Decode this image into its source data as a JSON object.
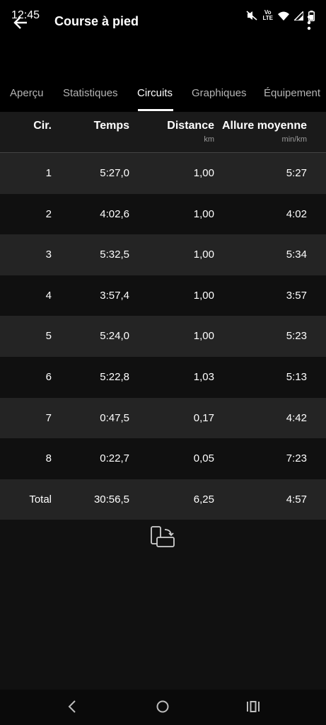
{
  "status": {
    "time": "12:45",
    "volte": "Vo\nLTE"
  },
  "appbar": {
    "title": "Course à pied"
  },
  "tabs": [
    "Aperçu",
    "Statistiques",
    "Circuits",
    "Graphiques",
    "Équipement"
  ],
  "table": {
    "headers": {
      "lap": "Cir.",
      "time": "Temps",
      "distance": "Distance",
      "distance_unit": "km",
      "pace": "Allure moyenne",
      "pace_unit": "min/km"
    },
    "rows": [
      {
        "lap": "1",
        "time": "5:27,0",
        "distance": "1,00",
        "pace": "5:27"
      },
      {
        "lap": "2",
        "time": "4:02,6",
        "distance": "1,00",
        "pace": "4:02"
      },
      {
        "lap": "3",
        "time": "5:32,5",
        "distance": "1,00",
        "pace": "5:34"
      },
      {
        "lap": "4",
        "time": "3:57,4",
        "distance": "1,00",
        "pace": "3:57"
      },
      {
        "lap": "5",
        "time": "5:24,0",
        "distance": "1,00",
        "pace": "5:23"
      },
      {
        "lap": "6",
        "time": "5:22,8",
        "distance": "1,03",
        "pace": "5:13"
      },
      {
        "lap": "7",
        "time": "0:47,5",
        "distance": "0,17",
        "pace": "4:42"
      },
      {
        "lap": "8",
        "time": "0:22,7",
        "distance": "0,05",
        "pace": "7:23"
      }
    ],
    "total": {
      "lap": "Total",
      "time": "30:56,5",
      "distance": "6,25",
      "pace": "4:57"
    }
  },
  "icons": {
    "back": "arrow-left-icon",
    "menu": "more-vert-icon",
    "rotate": "screen-rotation-icon",
    "mute": "vibrate-off-icon",
    "wifi": "wifi-icon",
    "signal": "signal-icon",
    "battery": "battery-icon"
  }
}
